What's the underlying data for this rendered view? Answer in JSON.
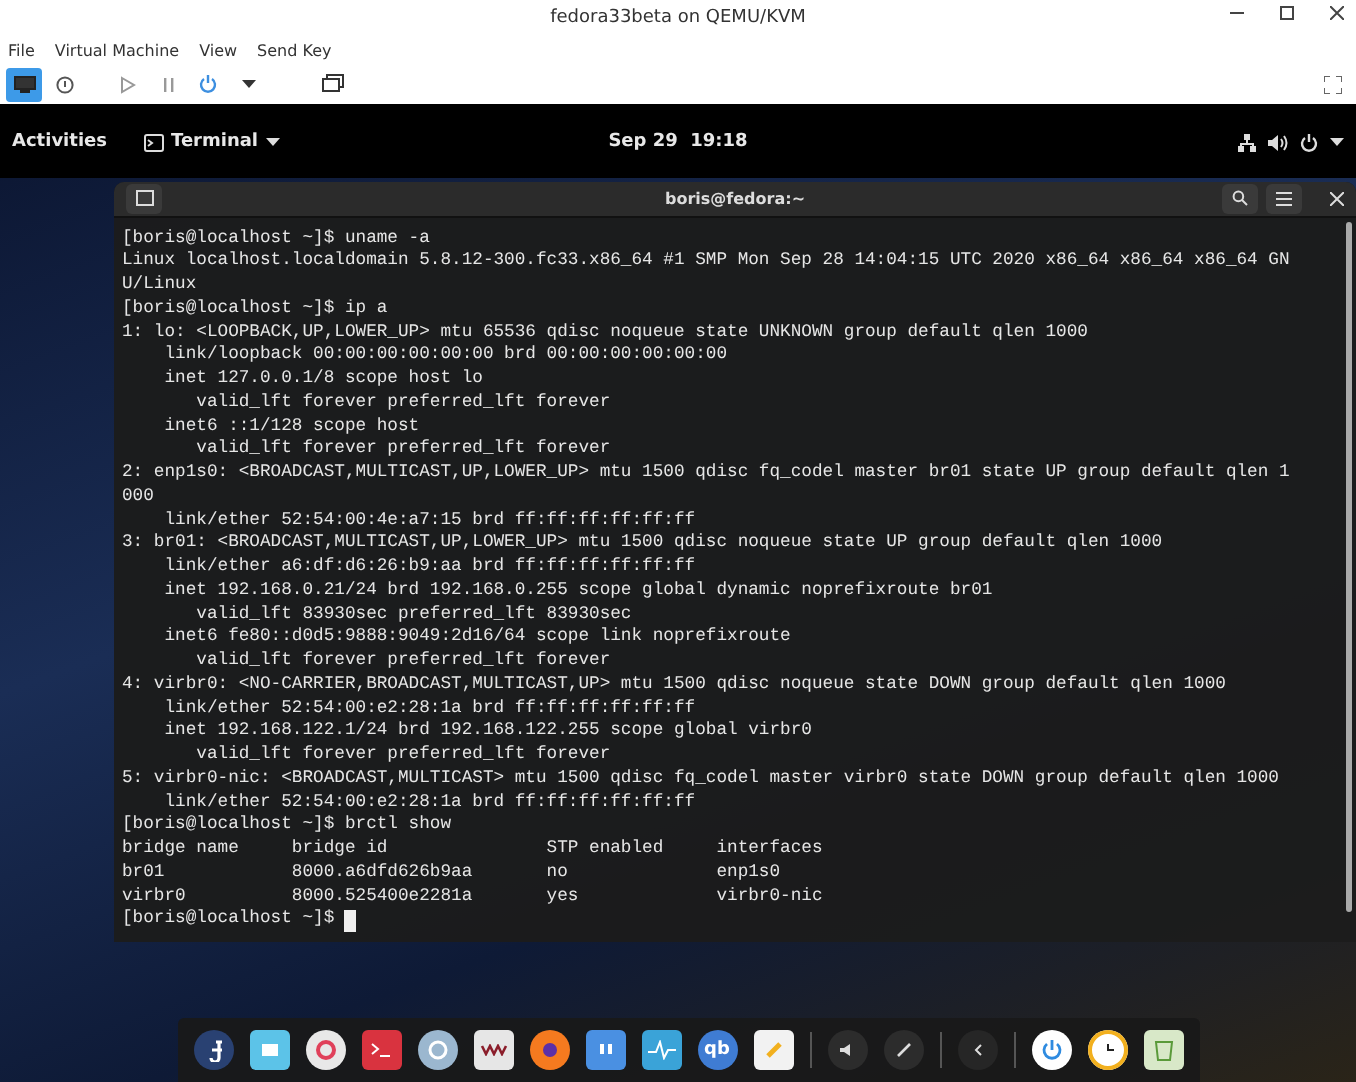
{
  "window": {
    "title": "fedora33beta on QEMU/KVM"
  },
  "menu": [
    "File",
    "Virtual Machine",
    "View",
    "Send Key"
  ],
  "toolbar": [
    {
      "kind": "monitor",
      "selected": true
    },
    {
      "kind": "info",
      "selected": false
    },
    {
      "kind": "play",
      "selected": false
    },
    {
      "kind": "pause",
      "selected": false
    },
    {
      "kind": "power",
      "selected": false
    },
    {
      "kind": "caret",
      "selected": false
    },
    {
      "kind": "screens",
      "selected": false
    }
  ],
  "top_bar": {
    "activities": "Activities",
    "app_menu": "Terminal",
    "clock": "Sep 29  19:18"
  },
  "terminal": {
    "title": "boris@fedora:~",
    "lines": [
      "[boris@localhost ~]$ uname -a",
      "Linux localhost.localdomain 5.8.12-300.fc33.x86_64 #1 SMP Mon Sep 28 14:04:15 UTC 2020 x86_64 x86_64 x86_64 GN",
      "U/Linux",
      "[boris@localhost ~]$ ip a",
      "1: lo: <LOOPBACK,UP,LOWER_UP> mtu 65536 qdisc noqueue state UNKNOWN group default qlen 1000",
      "    link/loopback 00:00:00:00:00:00 brd 00:00:00:00:00:00",
      "    inet 127.0.0.1/8 scope host lo",
      "       valid_lft forever preferred_lft forever",
      "    inet6 ::1/128 scope host",
      "       valid_lft forever preferred_lft forever",
      "2: enp1s0: <BROADCAST,MULTICAST,UP,LOWER_UP> mtu 1500 qdisc fq_codel master br01 state UP group default qlen 1",
      "000",
      "    link/ether 52:54:00:4e:a7:15 brd ff:ff:ff:ff:ff:ff",
      "3: br01: <BROADCAST,MULTICAST,UP,LOWER_UP> mtu 1500 qdisc noqueue state UP group default qlen 1000",
      "    link/ether a6:df:d6:26:b9:aa brd ff:ff:ff:ff:ff:ff",
      "    inet 192.168.0.21/24 brd 192.168.0.255 scope global dynamic noprefixroute br01",
      "       valid_lft 83930sec preferred_lft 83930sec",
      "    inet6 fe80::d0d5:9888:9049:2d16/64 scope link noprefixroute",
      "       valid_lft forever preferred_lft forever",
      "4: virbr0: <NO-CARRIER,BROADCAST,MULTICAST,UP> mtu 1500 qdisc noqueue state DOWN group default qlen 1000",
      "    link/ether 52:54:00:e2:28:1a brd ff:ff:ff:ff:ff:ff",
      "    inet 192.168.122.1/24 brd 192.168.122.255 scope global virbr0",
      "       valid_lft forever preferred_lft forever",
      "5: virbr0-nic: <BROADCAST,MULTICAST> mtu 1500 qdisc fq_codel master virbr0 state DOWN group default qlen 1000",
      "    link/ether 52:54:00:e2:28:1a brd ff:ff:ff:ff:ff:ff",
      "[boris@localhost ~]$ brctl show",
      "bridge name     bridge id               STP enabled     interfaces",
      "br01            8000.a6dfd626b9aa       no              enp1s0",
      "virbr0          8000.525400e2281a       yes             virbr0-nic",
      "[boris@localhost ~]$ "
    ]
  },
  "dock": [
    {
      "kind": "fedora"
    },
    {
      "kind": "files"
    },
    {
      "kind": "settings"
    },
    {
      "kind": "terminal"
    },
    {
      "kind": "disc"
    },
    {
      "kind": "virt"
    },
    {
      "kind": "firefox"
    },
    {
      "kind": "quote"
    },
    {
      "kind": "monitor"
    },
    {
      "kind": "qbit",
      "label": "qb"
    },
    {
      "kind": "notes"
    },
    {
      "kind": "sep"
    },
    {
      "kind": "volume"
    },
    {
      "kind": "pen"
    },
    {
      "kind": "sep"
    },
    {
      "kind": "chevron"
    },
    {
      "kind": "sep"
    },
    {
      "kind": "power"
    },
    {
      "kind": "clock"
    },
    {
      "kind": "trash"
    }
  ]
}
